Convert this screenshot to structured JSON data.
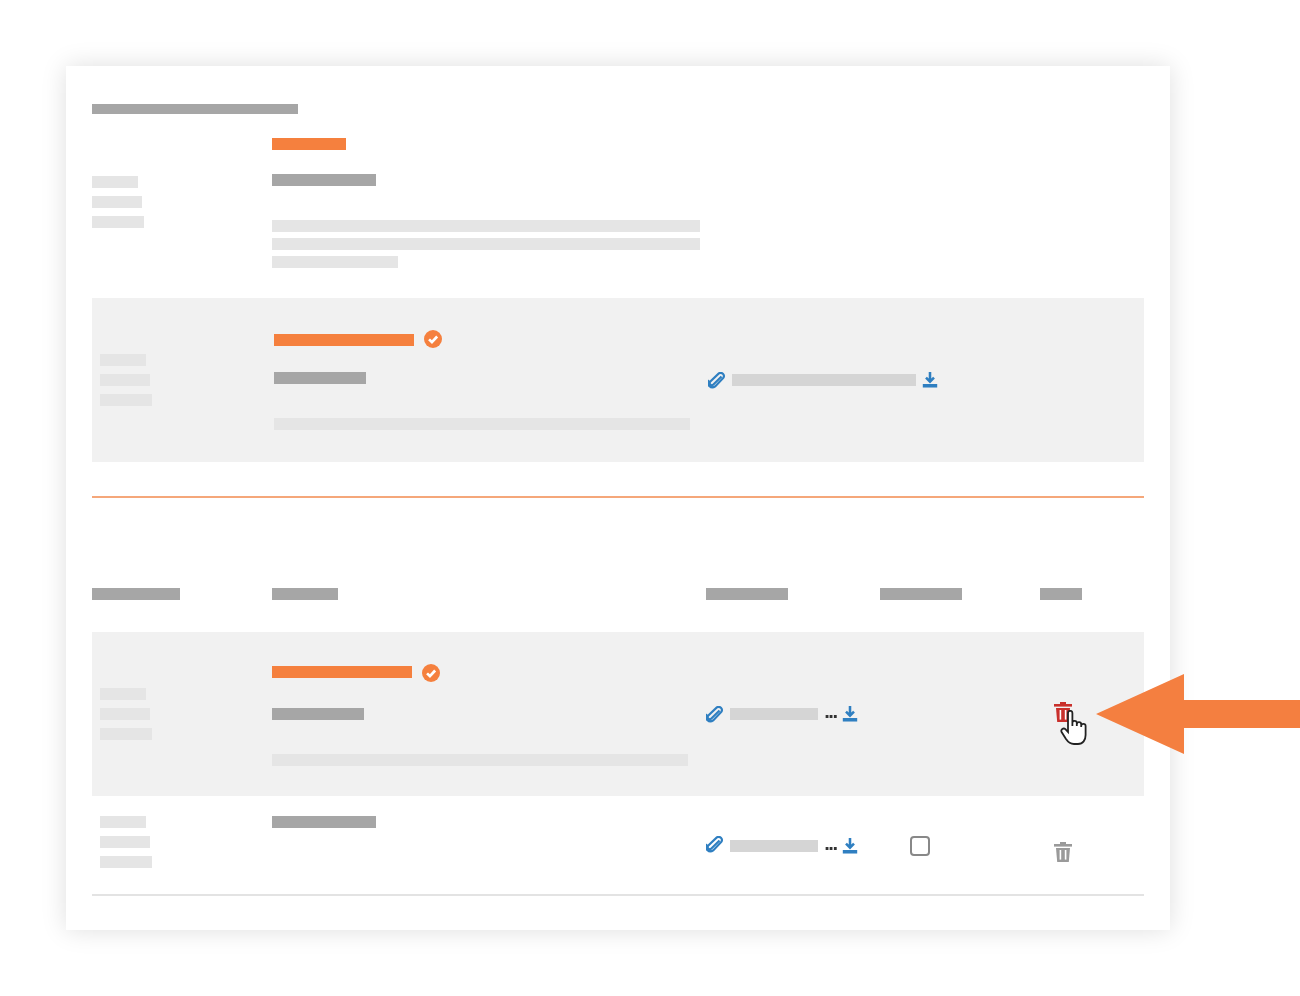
{
  "overview_rows": [
    {
      "kind": "note",
      "selected": false
    },
    {
      "kind": "file",
      "selected": true,
      "verified": true
    }
  ],
  "table": {
    "rows": [
      {
        "selected": true,
        "verified": true,
        "ellipsis": "...",
        "delete_hovered": true
      },
      {
        "selected": false,
        "verified": false,
        "ellipsis": "...",
        "checkbox": {
          "checked": false
        },
        "delete_hovered": false
      }
    ]
  },
  "callout_arrow": true
}
